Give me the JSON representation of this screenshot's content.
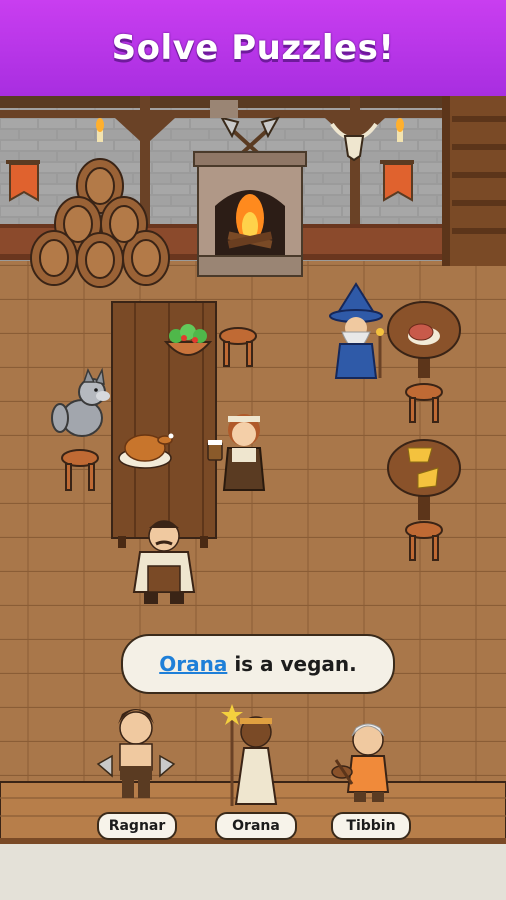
{
  "banner": {
    "title": "Solve Puzzles!"
  },
  "hint": {
    "name": "Orana",
    "text": "is a vegan."
  },
  "characters": [
    {
      "name": "Ragnar"
    },
    {
      "name": "Orana"
    },
    {
      "name": "Tibbin"
    }
  ],
  "colors": {
    "banner": "#b934e8",
    "floor": "#a9774a",
    "stone_wall": "#8f8f8f",
    "hint_name": "#1e7fd8"
  }
}
